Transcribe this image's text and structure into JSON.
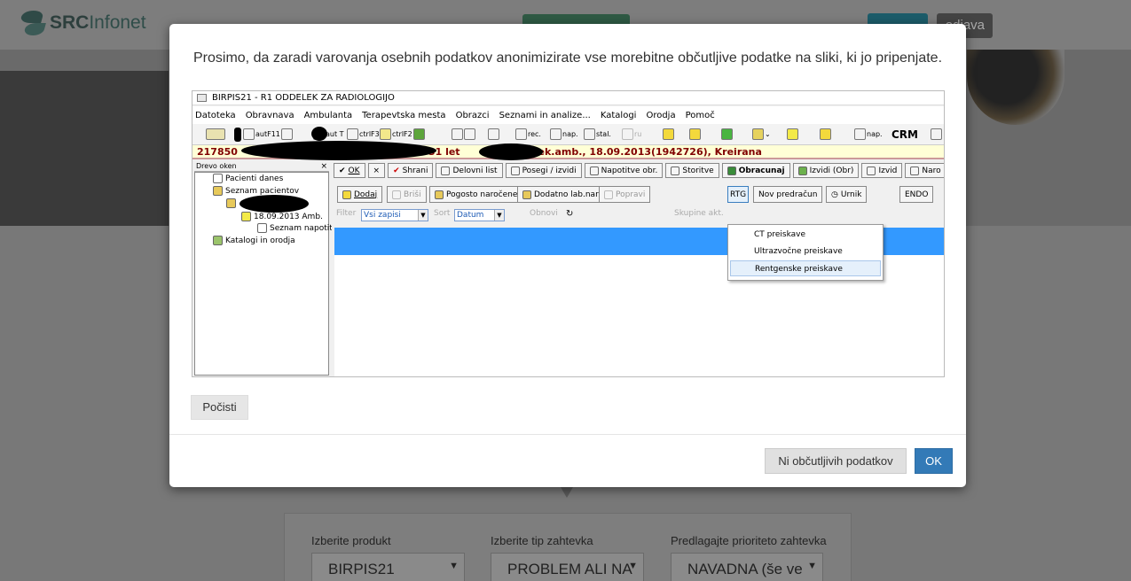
{
  "background": {
    "logo_strong": "SRC",
    "logo_light": "Infonet",
    "header_right_label": "odjava",
    "form": {
      "product_label": "Izberite produkt",
      "product_value": "BIRPIS21",
      "type_label": "Izberite tip zahtevka",
      "type_value": "PROBLEM ALI NA",
      "priority_label": "Predlagajte prioriteto zahtevka",
      "priority_value": "NAVADNA (še ve"
    }
  },
  "modal": {
    "message": "Prosimo, da zaradi varovanja osebnih podatkov anonimizirate vse morebitne občutljive podatke na sliki, ki jo pripenjate.",
    "clear_button": "Počisti",
    "no_sensitive_button": "Ni občutljivih podatkov",
    "ok_button": "OK"
  },
  "screenshot": {
    "title": "BIRPIS21 - R1 ODDELEK ZA RADIOLOGIJO",
    "menu": [
      "Datoteka",
      "Obravnava",
      "Ambulanta",
      "Terapevtska mesta",
      "Obrazci",
      "Seznami in analize...",
      "Katalogi",
      "Orodja",
      "Pomoč"
    ],
    "toolbar": {
      "f11": "autF11",
      "t": "aut T",
      "f3": "ctrlF3",
      "f2": "ctrlF2",
      "rec": "rec.",
      "nap1": "nap.",
      "stal": "stal.",
      "ru": "ru",
      "nap2": "nap.",
      "crm": "CRM"
    },
    "patient_prefix": "217850",
    "patient_middle": "31 let",
    "patient_suffix": ", Sek.amb., 18.09.2013(1942726), Kreirana",
    "tree_header": "Drevo oken",
    "tree_close": "×",
    "tree": {
      "pacienti_danes": "Pacienti danes",
      "seznam_pacientov": "Seznam pacientov",
      "amb_date": "18.09.2013 Amb.",
      "seznam_napotitev": "Seznam napotitev",
      "katalogi": "Katalogi in orodja"
    },
    "row1": {
      "ok": "OK",
      "x": "×",
      "shrani": "Shrani",
      "delovni_list": "Delovni list",
      "posegi": "Posegi / izvidi",
      "napotitve": "Napotitve obr.",
      "storitve": "Storitve",
      "obracunaj": "Obracunaj",
      "izvidi_obr": "Izvidi (Obr)",
      "izvid": "Izvid",
      "naro": "Naro"
    },
    "row2": {
      "dodaj": "Dodaj",
      "brisi": "Briši",
      "pogosto": "Pogosto naročene",
      "dodatno": "Dodatno lab.nar.",
      "popravi": "Popravi",
      "rtg": "RTG",
      "nov_predracun": "Nov predračun",
      "urnik": "Urnik",
      "endo": "ENDO"
    },
    "filter": {
      "filter_label": "Filter",
      "filter_value": "Vsi zapisi",
      "sort_label": "Sort",
      "sort_value": "Datum",
      "obnovi": "Obnovi",
      "skupine": "Skupine akt."
    },
    "popup": [
      "CT preiskave",
      "Ultrazvočne preiskave",
      "Rentgenske preiskave"
    ]
  }
}
